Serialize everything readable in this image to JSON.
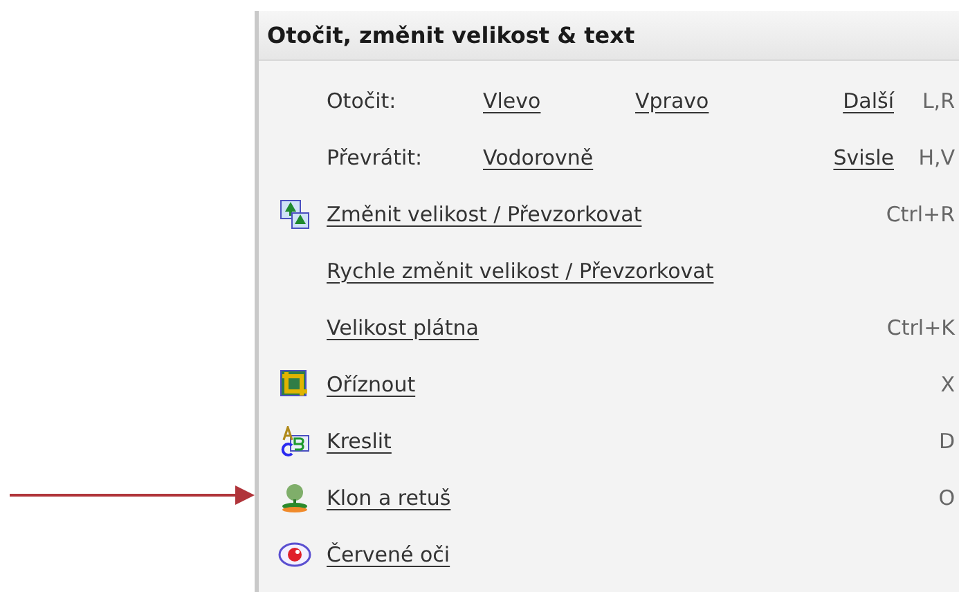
{
  "panel": {
    "title": "Otočit, změnit velikost & text",
    "rows": [
      {
        "kind": "options",
        "label": "Otočit:",
        "links": [
          "Vlevo",
          "Vpravo"
        ],
        "right_link": "Další",
        "shortcut": "L,R"
      },
      {
        "kind": "options",
        "label": "Převrátit:",
        "links": [
          "Vodorovně"
        ],
        "right_link": "Svisle",
        "shortcut": "H,V"
      },
      {
        "kind": "resize",
        "label": "Změnit velikost / Převzorkovat",
        "shortcut": "Ctrl+R"
      },
      {
        "kind": "command",
        "label": "Rychle změnit velikost / Převzorkovat"
      },
      {
        "kind": "command",
        "label": "Velikost plátna",
        "shortcut": "Ctrl+K"
      },
      {
        "kind": "crop",
        "label": "Oříznout",
        "shortcut": "X"
      },
      {
        "kind": "draw",
        "label": "Kreslit",
        "shortcut": "D"
      },
      {
        "kind": "stamp",
        "label": "Klon a retuš",
        "shortcut": "O",
        "pointed": true
      },
      {
        "kind": "eye",
        "label": "Červené oči"
      }
    ]
  }
}
